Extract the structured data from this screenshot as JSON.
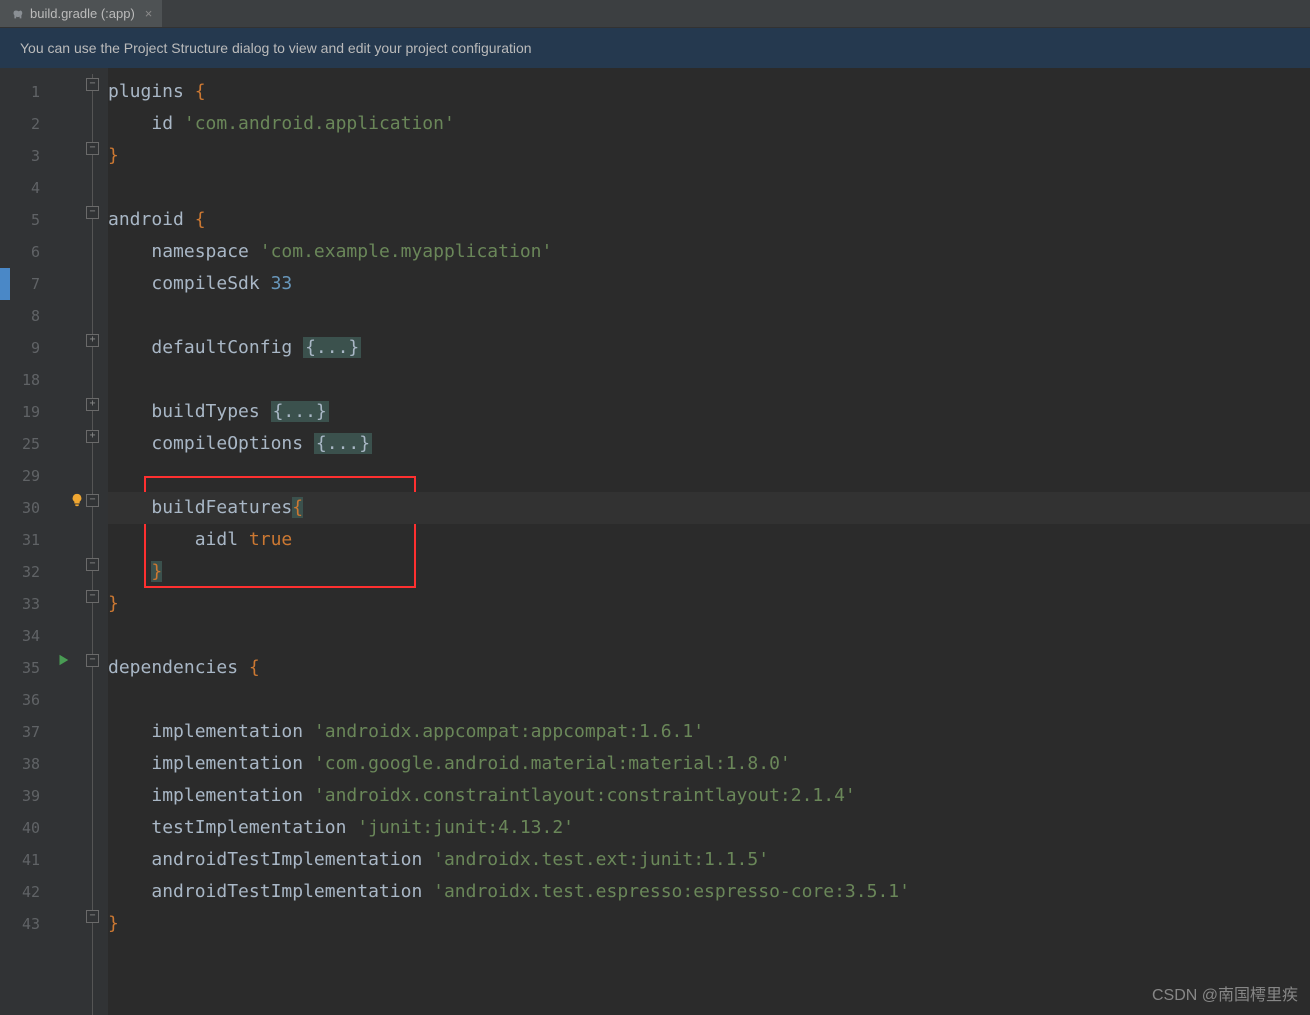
{
  "tab": {
    "label": "build.gradle (:app)"
  },
  "banner": {
    "text": "You can use the Project Structure dialog to view and edit your project configuration"
  },
  "gutter_lines": [
    "1",
    "2",
    "3",
    "4",
    "5",
    "6",
    "7",
    "8",
    "9",
    "18",
    "19",
    "25",
    "29",
    "30",
    "31",
    "32",
    "33",
    "34",
    "35",
    "36",
    "37",
    "38",
    "39",
    "40",
    "41",
    "42",
    "43"
  ],
  "code": {
    "l1_kw": "plugins ",
    "l1_brace": "{",
    "l2_id": "id ",
    "l2_str": "'com.android.application'",
    "l3_brace": "}",
    "l5_kw": "android ",
    "l5_brace": "{",
    "l6_id": "namespace ",
    "l6_str": "'com.example.myapplication'",
    "l7_id": "compileSdk ",
    "l7_num": "33",
    "l9_id": "defaultConfig ",
    "l9_fold": "{...}",
    "l19_id": "buildTypes ",
    "l19_fold": "{...}",
    "l25_id": "compileOptions ",
    "l25_fold": "{...}",
    "l30_id": "buildFeatures",
    "l30_brace": "{",
    "l31_id": "aidl ",
    "l31_kw": "true",
    "l32_brace": "}",
    "l33_brace": "}",
    "l35_kw": "dependencies ",
    "l35_brace": "{",
    "l37_id": "implementation ",
    "l37_str": "'androidx.appcompat:appcompat:1.6.1'",
    "l38_id": "implementation ",
    "l38_str": "'com.google.android.material:material:1.8.0'",
    "l39_id": "implementation ",
    "l39_str": "'androidx.constraintlayout:constraintlayout:2.1.4'",
    "l40_id": "testImplementation ",
    "l40_str": "'junit:junit:4.13.2'",
    "l41_id": "androidTestImplementation ",
    "l41_str": "'androidx.test.ext:junit:1.1.5'",
    "l42_id": "androidTestImplementation ",
    "l42_str": "'androidx.test.espresso:espresso-core:3.5.1'",
    "l43_brace": "}"
  },
  "watermark": "CSDN @南国樗里疾"
}
